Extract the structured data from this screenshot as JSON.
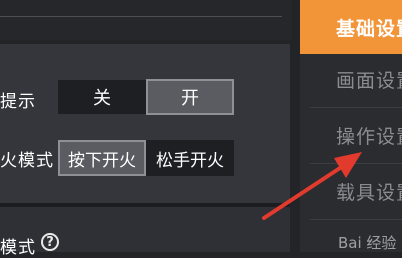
{
  "settings": {
    "row1_label": "提示",
    "row1_options": [
      "关",
      "开"
    ],
    "row1_selected": "开",
    "row2_label": "火模式",
    "row2_options": [
      "按下开火",
      "松手开火"
    ],
    "row2_selected": "按下开火",
    "row3_label": "模式",
    "help_icon_glyph": "?"
  },
  "sidebar": {
    "items": [
      {
        "label": "基础设置",
        "active": true
      },
      {
        "label": "画面设置",
        "active": false
      },
      {
        "label": "操作设置",
        "active": false
      },
      {
        "label": "载具设置",
        "active": false
      }
    ]
  },
  "watermark": "Bai 经验",
  "colors": {
    "accent": "#f29438",
    "arrow": "#e23b2e",
    "panel": "#35363b",
    "selected_segment": "#5a5c62"
  },
  "icons": {
    "help": "question-circle-icon",
    "annotation": "red-arrow-icon"
  }
}
